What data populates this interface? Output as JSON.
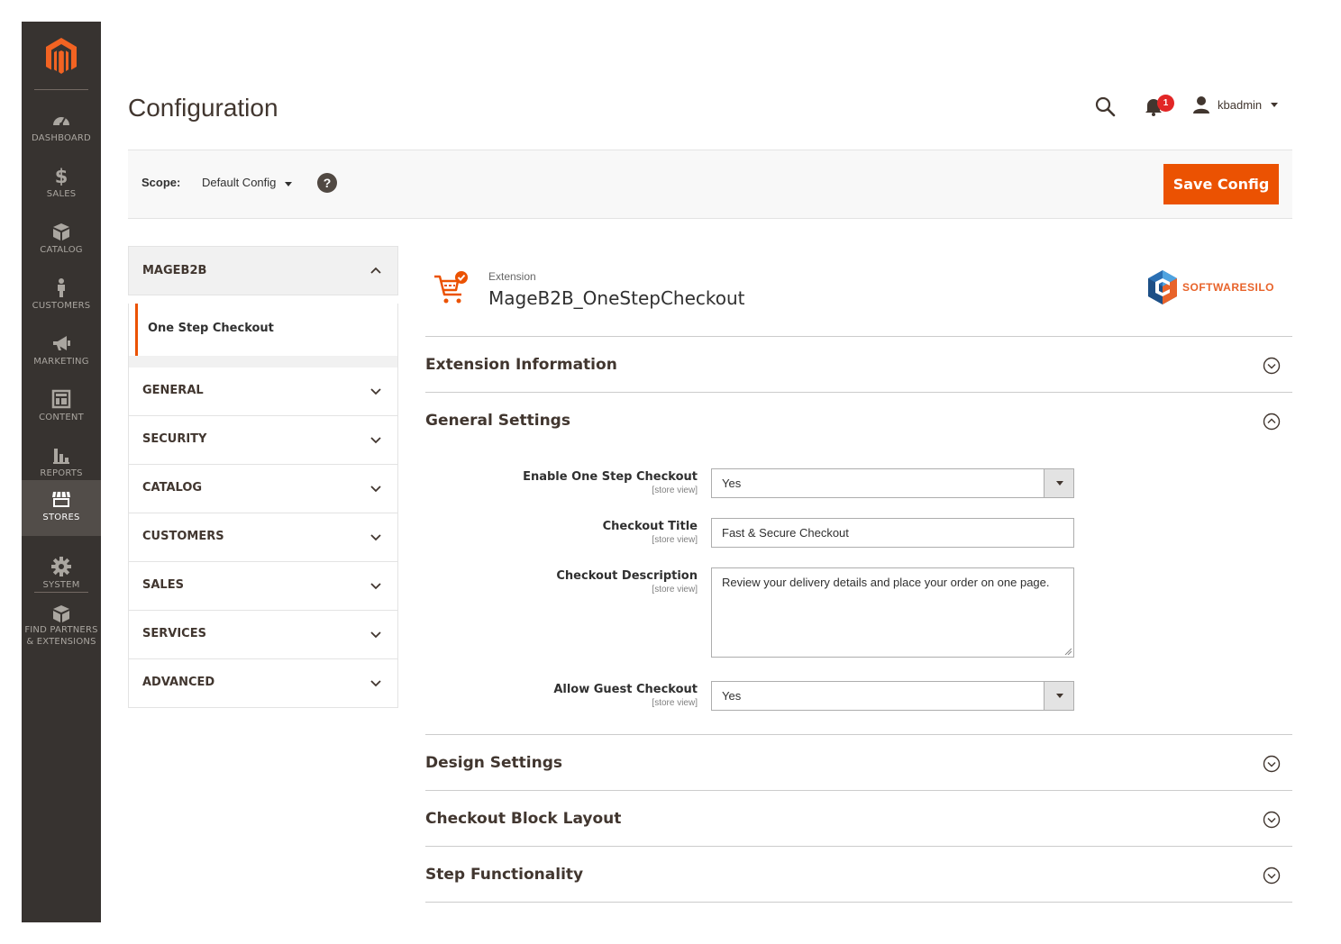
{
  "sidebar": {
    "logo": "magento-logo",
    "items": [
      {
        "label": "DASHBOARD",
        "icon": "dashboard-icon"
      },
      {
        "label": "SALES",
        "icon": "dollar-icon"
      },
      {
        "label": "CATALOG",
        "icon": "box-icon"
      },
      {
        "label": "CUSTOMERS",
        "icon": "person-icon"
      },
      {
        "label": "MARKETING",
        "icon": "megaphone-icon"
      },
      {
        "label": "CONTENT",
        "icon": "layout-icon"
      },
      {
        "label": "REPORTS",
        "icon": "bar-chart-icon"
      },
      {
        "label": "STORES",
        "icon": "store-icon",
        "active": true
      },
      {
        "label": "SYSTEM",
        "icon": "gear-icon"
      },
      {
        "label_line1": "FIND PARTNERS",
        "label_line2": "& EXTENSIONS",
        "icon": "partners-icon"
      }
    ]
  },
  "header": {
    "title": "Configuration",
    "notifications_count": "1",
    "username": "kbadmin"
  },
  "scope": {
    "label": "Scope:",
    "value": "Default Config",
    "help": "?",
    "save_label": "Save Config"
  },
  "tabs": {
    "group_title": "MAGEB2B",
    "active_item": "One Step Checkout",
    "items": [
      "GENERAL",
      "SECURITY",
      "CATALOG",
      "CUSTOMERS",
      "SALES",
      "SERVICES",
      "ADVANCED"
    ]
  },
  "extension": {
    "kicker": "Extension",
    "name": "MageB2B_OneStepCheckout",
    "brand": "SOFTWARESILO"
  },
  "sections": [
    "Extension Information",
    "General Settings",
    "Design Settings",
    "Checkout Block Layout",
    "Step Functionality"
  ],
  "fields": {
    "enable": {
      "label": "Enable One Step Checkout",
      "scope": "[store view]",
      "value": "Yes"
    },
    "title": {
      "label": "Checkout Title",
      "scope": "[store view]",
      "value": "Fast & Secure Checkout"
    },
    "description": {
      "label": "Checkout Description",
      "scope": "[store view]",
      "value": "Review your delivery details and place your order on one page."
    },
    "guest": {
      "label": "Allow Guest Checkout",
      "scope": "[store view]",
      "value": "Yes"
    }
  },
  "colors": {
    "sidebar_bg": "#373330",
    "accent": "#eb5202",
    "badge": "#e22626"
  }
}
